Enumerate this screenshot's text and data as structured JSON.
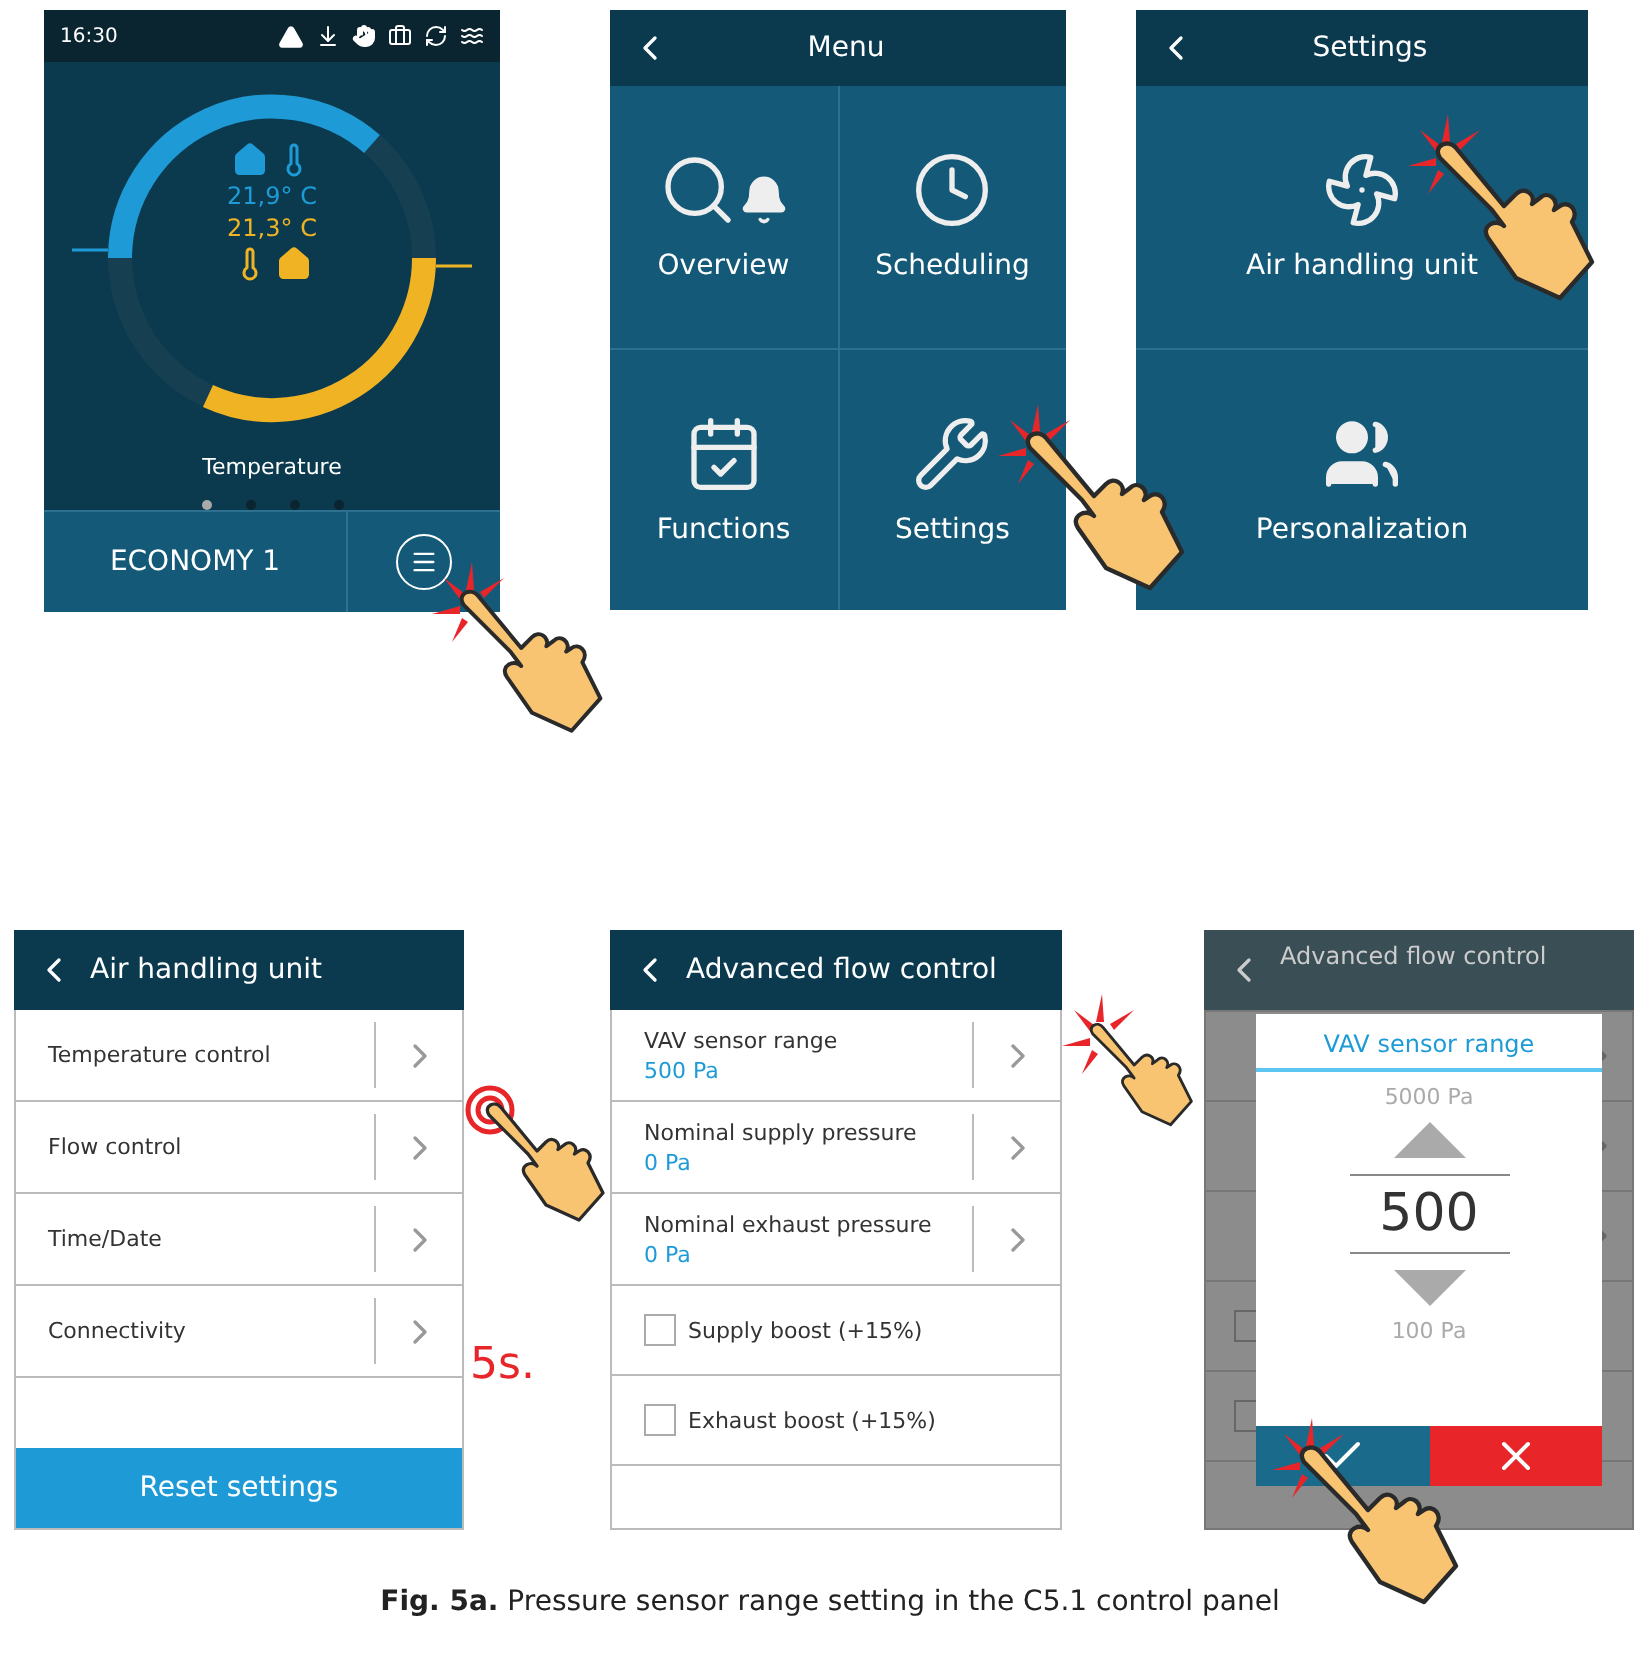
{
  "screens": [
    {
      "kind": "home",
      "time": "16:30",
      "supply_temp": "21,9° C",
      "extract_temp": "21,3° C",
      "label": "Temperature",
      "pages": [
        {
          "selected": true
        },
        {
          "selected": false
        },
        {
          "selected": false
        },
        {
          "selected": false
        }
      ],
      "mode": "ECONOMY 1"
    },
    {
      "kind": "tiles",
      "title": "Menu",
      "tiles": [
        {
          "label": "Overview"
        },
        {
          "label": "Scheduling"
        },
        {
          "label": "Functions"
        },
        {
          "label": "Settings"
        }
      ]
    },
    {
      "kind": "tiles",
      "title": "Settings",
      "tiles": [
        {
          "label": "Air handling unit"
        },
        {
          "label": "Personalization"
        }
      ]
    },
    {
      "kind": "list",
      "title": "Air handling unit",
      "hold_time": "5s.",
      "rows": [
        {
          "kind": "link",
          "label": "Temperature control"
        },
        {
          "kind": "link",
          "label": "Flow control"
        },
        {
          "kind": "link",
          "label": "Time/Date"
        },
        {
          "kind": "link",
          "label": "Connectivity"
        }
      ],
      "button": "Reset settings"
    },
    {
      "kind": "list",
      "title": "Advanced flow control",
      "rows": [
        {
          "kind": "value",
          "label": "VAV sensor range",
          "value": "500 Pa"
        },
        {
          "kind": "value",
          "label": "Nominal supply pressure",
          "value": "0 Pa"
        },
        {
          "kind": "value",
          "label": "Nominal exhaust pressure",
          "value": "0 Pa"
        },
        {
          "kind": "checkbox",
          "label": "Supply boost (+15%)",
          "checked": false
        },
        {
          "kind": "checkbox",
          "label": "Exhaust boost (+15%)",
          "checked": false
        }
      ]
    },
    {
      "kind": "dialog",
      "title": "Advanced flow control",
      "dialog": {
        "title": "VAV sensor range",
        "max": "5000 Pa",
        "value": "500",
        "min": "100 Pa"
      }
    }
  ],
  "caption": "**Fig. 5a.** Pressure sensor range setting in the C5.1 control panel"
}
